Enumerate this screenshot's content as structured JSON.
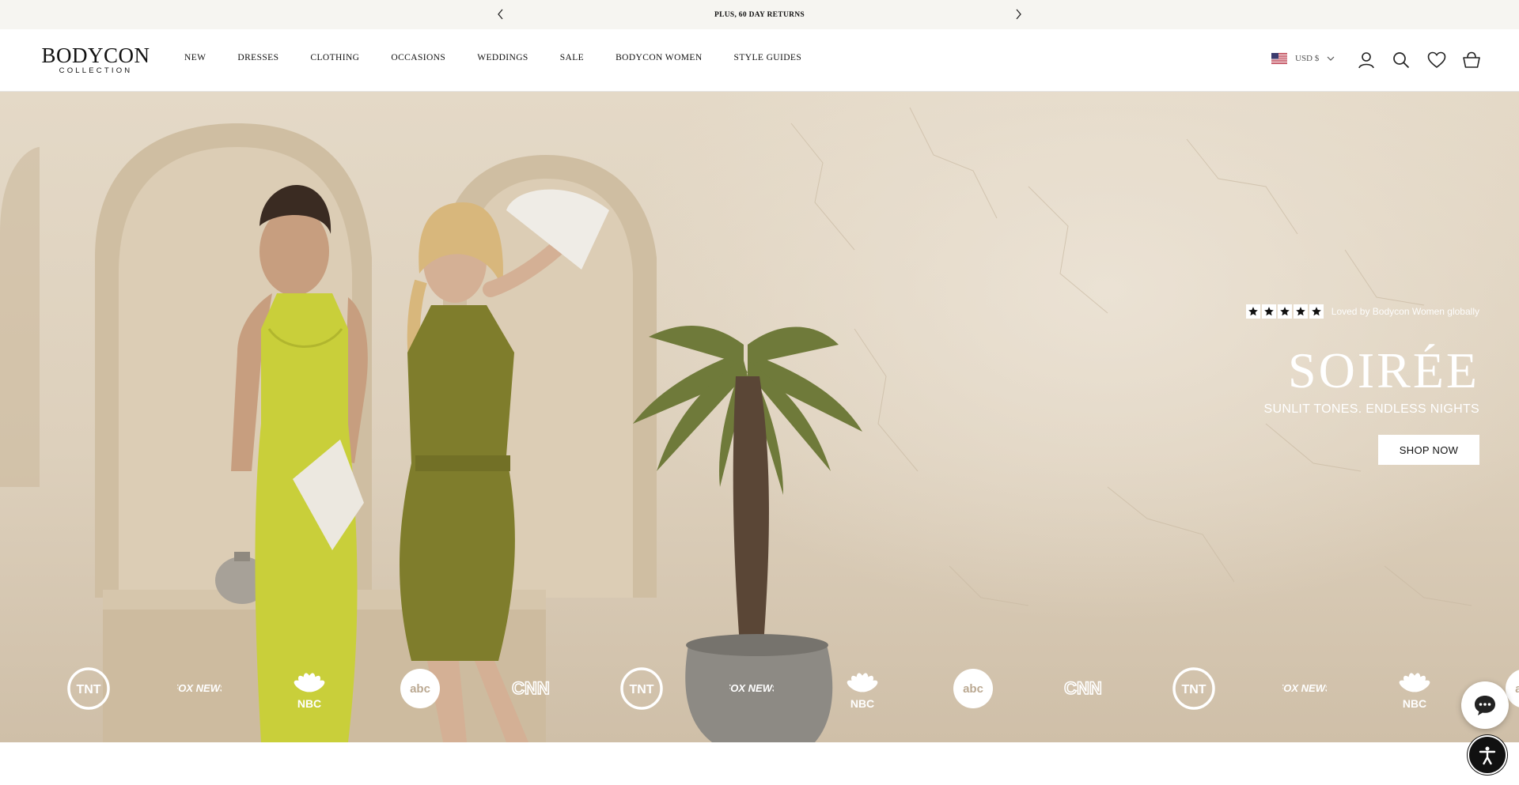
{
  "announcement": {
    "text": "PLUS, 60 DAY RETURNS",
    "prev_icon": "chevron-left-icon",
    "next_icon": "chevron-right-icon"
  },
  "header": {
    "logo_main": "BODYCON",
    "logo_sub": "COLLECTION",
    "nav": [
      "NEW",
      "DRESSES",
      "CLOTHING",
      "OCCASIONS",
      "WEDDINGS",
      "SALE",
      "BODYCON WOMEN",
      "STYLE GUIDES"
    ],
    "currency": "USD $",
    "icons": [
      "account-icon",
      "search-icon",
      "heart-icon",
      "basket-icon"
    ]
  },
  "hero": {
    "reviews_text": "Loved by Bodycon Women globally",
    "rating_stars": 5,
    "title": "SOIRÉE",
    "subtitle": "SUNLIT TONES. ENDLESS NIGHTS",
    "cta": "SHOP NOW",
    "media_logos": [
      "TNT",
      "FOX NEWS",
      "NBC",
      "abc",
      "CNN",
      "TNT",
      "FOX NEWS",
      "NBC",
      "abc",
      "CNN",
      "TNT",
      "FOX NEWS",
      "NBC",
      "abc"
    ]
  },
  "colors": {
    "announcement_bg": "#f6f5f1",
    "text": "#111111",
    "hero_wall": "#e4d9c7",
    "dress_lime": "#c9cf3a",
    "dress_olive": "#7f7d2c"
  }
}
